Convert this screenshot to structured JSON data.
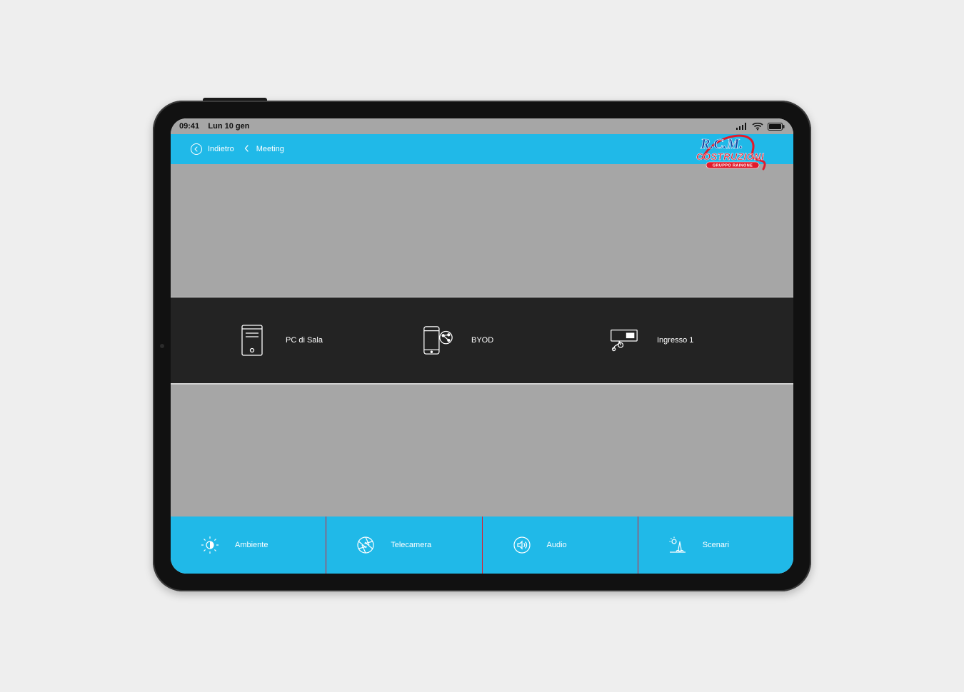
{
  "status": {
    "time": "09:41",
    "date": "Lun 10 gen"
  },
  "topbar": {
    "back_label": "Indietro",
    "crumb_label": "Meeting",
    "logo": {
      "line1": "R.C.M.",
      "line2": "COSTRUZIONI",
      "line3": "GRUPPO RAINONE"
    }
  },
  "sources": [
    {
      "icon": "pc-tower-icon",
      "label": "PC di Sala"
    },
    {
      "icon": "phone-share-icon",
      "label": "BYOD"
    },
    {
      "icon": "input-port-icon",
      "label": "Ingresso 1"
    }
  ],
  "bottom": [
    {
      "icon": "brightness-icon",
      "label": "Ambiente"
    },
    {
      "icon": "aperture-icon",
      "label": "Telecamera"
    },
    {
      "icon": "speaker-icon",
      "label": "Audio"
    },
    {
      "icon": "scene-icon",
      "label": "Scenari"
    }
  ],
  "colors": {
    "accent": "#20b9e8",
    "divider": "#e11b2c",
    "panel_dark": "#232323",
    "panel_grey": "#a6a6a6"
  }
}
